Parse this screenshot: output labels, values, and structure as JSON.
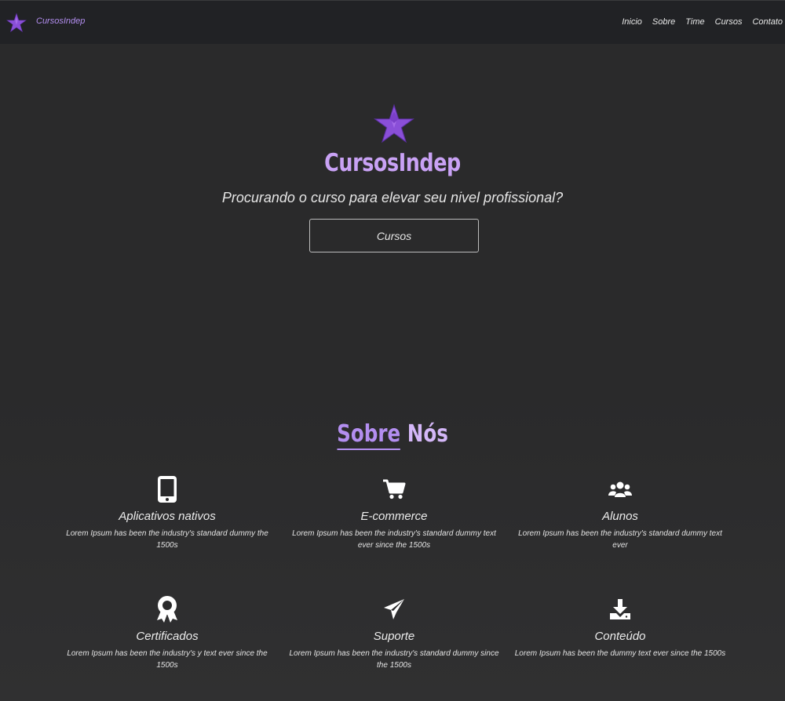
{
  "navbar": {
    "brand": "CursosIndep",
    "links": [
      "Inicio",
      "Sobre",
      "Time",
      "Cursos",
      "Contato"
    ]
  },
  "hero": {
    "title": "CursosIndep",
    "subtitle": "Procurando o curso para elevar seu nivel profissional?",
    "button": "Cursos"
  },
  "about": {
    "title_part1": "Sobre",
    "title_part2": "Nós",
    "features": [
      {
        "icon": "mobile-icon",
        "title": "Aplicativos nativos",
        "text": "Lorem Ipsum has been the industry's standard dummy the 1500s"
      },
      {
        "icon": "cart-icon",
        "title": "E-commerce",
        "text": "Lorem Ipsum has been the industry's standard dummy text ever since the 1500s"
      },
      {
        "icon": "users-icon",
        "title": "Alunos",
        "text": "Lorem Ipsum has been the industry's standard dummy text ever"
      },
      {
        "icon": "certificate-icon",
        "title": "Certificados",
        "text": "Lorem Ipsum has been the industry's y text ever since the 1500s"
      },
      {
        "icon": "paper-plane-icon",
        "title": "Suporte",
        "text": "Lorem Ipsum has been the industry's standard dummy since the 1500s"
      },
      {
        "icon": "download-icon",
        "title": "Conteúdo",
        "text": "Lorem Ipsum has been the dummy text ever since the 1500s"
      }
    ]
  },
  "colors": {
    "accent": "#b38ef0",
    "background": "#2a2a2b",
    "navbar": "#212225"
  }
}
